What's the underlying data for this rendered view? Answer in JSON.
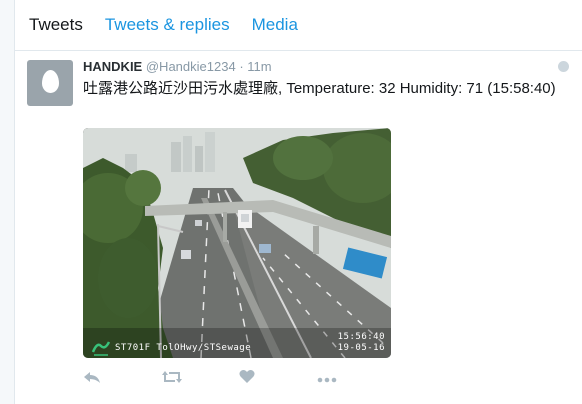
{
  "tabs": [
    {
      "label": "Tweets"
    },
    {
      "label": "Tweets & replies"
    },
    {
      "label": "Media"
    }
  ],
  "tweet": {
    "name": "HANDKIE",
    "handle": "@Handkie1234",
    "separator": "·",
    "time": "11m",
    "text": "吐露港公路近沙田污水處理廠, Temperature: 32 Humidity: 71 (15:58:40)",
    "image": {
      "overlay_time": "15:56:40",
      "overlay_camera": "ST701F  TolOHwy/STSewage",
      "overlay_date": "19-05-16"
    }
  },
  "icons": {
    "reply": "reply-icon",
    "retweet": "retweet-icon",
    "like": "heart-icon",
    "more": "more-icon",
    "globe": "globe-icon"
  },
  "colors": {
    "accent": "#1b95e0",
    "muted": "#8899a6",
    "action": "#aab8c2"
  }
}
